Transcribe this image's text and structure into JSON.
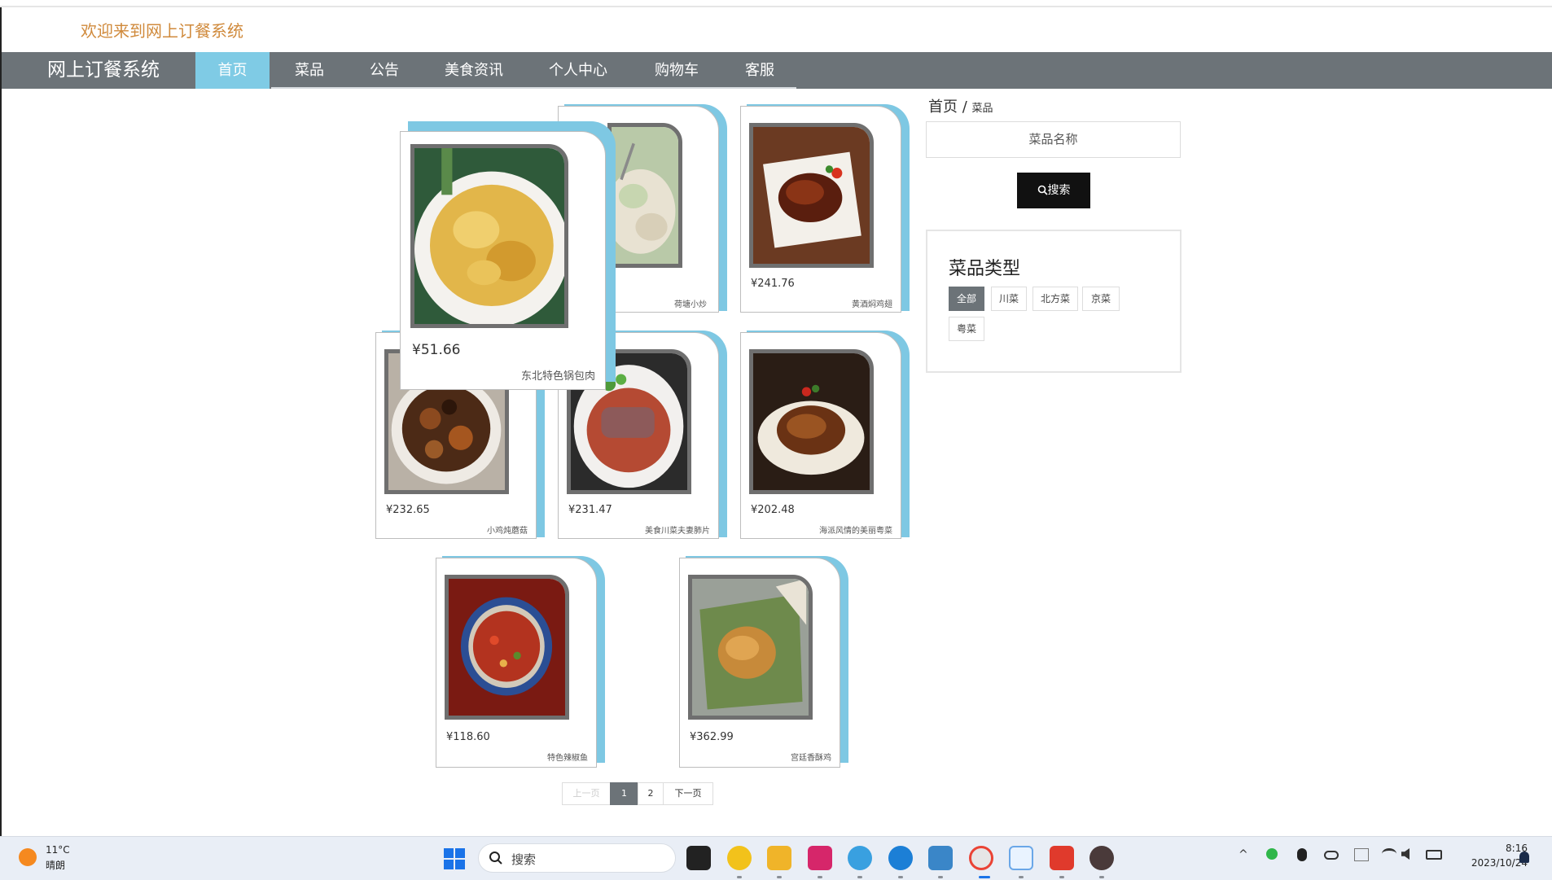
{
  "header": {
    "welcome": "欢迎来到网上订餐系统"
  },
  "nav": {
    "brand": "网上订餐系统",
    "items": [
      {
        "label": "首页",
        "active": true
      },
      {
        "label": "菜品"
      },
      {
        "label": "公告"
      },
      {
        "label": "美食资讯"
      },
      {
        "label": "个人中心"
      },
      {
        "label": "购物车"
      },
      {
        "label": "客服"
      }
    ]
  },
  "dishes": [
    {
      "price": "¥51.66",
      "name": "东北特色锅包肉"
    },
    {
      "price": "",
      "name": "荷塘小炒"
    },
    {
      "price": "¥241.76",
      "name": "黄酒焖鸡翅"
    },
    {
      "price": "¥232.65",
      "name": "小鸡炖蘑菇"
    },
    {
      "price": "¥231.47",
      "name": "美食川菜夫妻肺片"
    },
    {
      "price": "¥202.48",
      "name": "海派风情的美丽粤菜"
    },
    {
      "price": "¥118.60",
      "name": "特色辣椒鱼"
    },
    {
      "price": "¥362.99",
      "name": "宫廷香酥鸡"
    }
  ],
  "breadcrumb": {
    "home": "首页",
    "separator": "/",
    "current": "菜品"
  },
  "search": {
    "placeholder": "菜品名称",
    "button": "搜索"
  },
  "categories": {
    "title": "菜品类型",
    "items": [
      "全部",
      "川菜",
      "北方菜",
      "京菜",
      "粤菜"
    ],
    "active": "全部"
  },
  "pagination": {
    "prev": "上一页",
    "pages": [
      "1",
      "2"
    ],
    "current": "1",
    "next": "下一页"
  },
  "taskbar": {
    "weather_temp": "11°C",
    "weather_desc": "晴朗",
    "search_label": "搜索",
    "time": "8:16",
    "date": "2023/10/24"
  },
  "colors": {
    "nav_bg": "#6c7378",
    "nav_active": "#7fcbe5",
    "card_accent": "#7ec8e3",
    "welcome_text": "#d08a3c",
    "search_button": "#111111"
  }
}
